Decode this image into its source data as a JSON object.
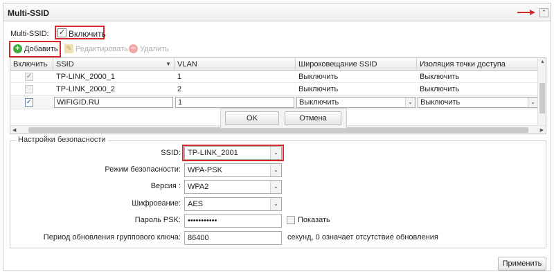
{
  "panel": {
    "title": "Multi-SSID",
    "collapse_glyph": "⌃"
  },
  "multi_ssid": {
    "label": "Multi-SSID:",
    "enable_label": "Включить",
    "enabled": true
  },
  "toolbar": {
    "add_label": "Добавить",
    "edit_label": "Редактировать",
    "delete_label": "Удалить",
    "add_icon": "plus-circle-icon",
    "edit_icon": "edit-icon",
    "delete_icon": "minus-circle-icon"
  },
  "grid": {
    "columns": [
      "Включить",
      "SSID",
      "VLAN",
      "Широковещание SSID",
      "Изоляция точки доступа"
    ],
    "rows": [
      {
        "enabled": true,
        "ssid": "TP-LINK_2000_1",
        "vlan": "1",
        "broadcast": "Выключить",
        "isolation": "Выключить"
      },
      {
        "enabled": false,
        "ssid": "TP-LINK_2000_2",
        "vlan": "2",
        "broadcast": "Выключить",
        "isolation": "Выключить"
      }
    ],
    "edit_row": {
      "enabled": true,
      "ssid": "WIFIGID.RU",
      "vlan": "1",
      "broadcast": "Выключить",
      "isolation": "Выключить"
    },
    "ok_label": "OK",
    "cancel_label": "Отмена"
  },
  "security": {
    "legend": "Настройки безопасности",
    "ssid_label": "SSID:",
    "ssid_value": "TP-LINK_2001",
    "mode_label": "Режим безопасности:",
    "mode_value": "WPA-PSK",
    "version_label": "Версия :",
    "version_value": "WPA2",
    "encryption_label": "Шифрование:",
    "encryption_value": "AES",
    "psk_label": "Пароль PSK:",
    "psk_value": "•••••••••••",
    "show_label": "Показать",
    "rekey_label": "Период обновления группового ключа:",
    "rekey_value": "86400",
    "rekey_hint": "секунд, 0 означает отсутствие обновления"
  },
  "apply_label": "Применить",
  "colors": {
    "highlight_red": "#d9262b",
    "add_green": "#3fae3c"
  }
}
